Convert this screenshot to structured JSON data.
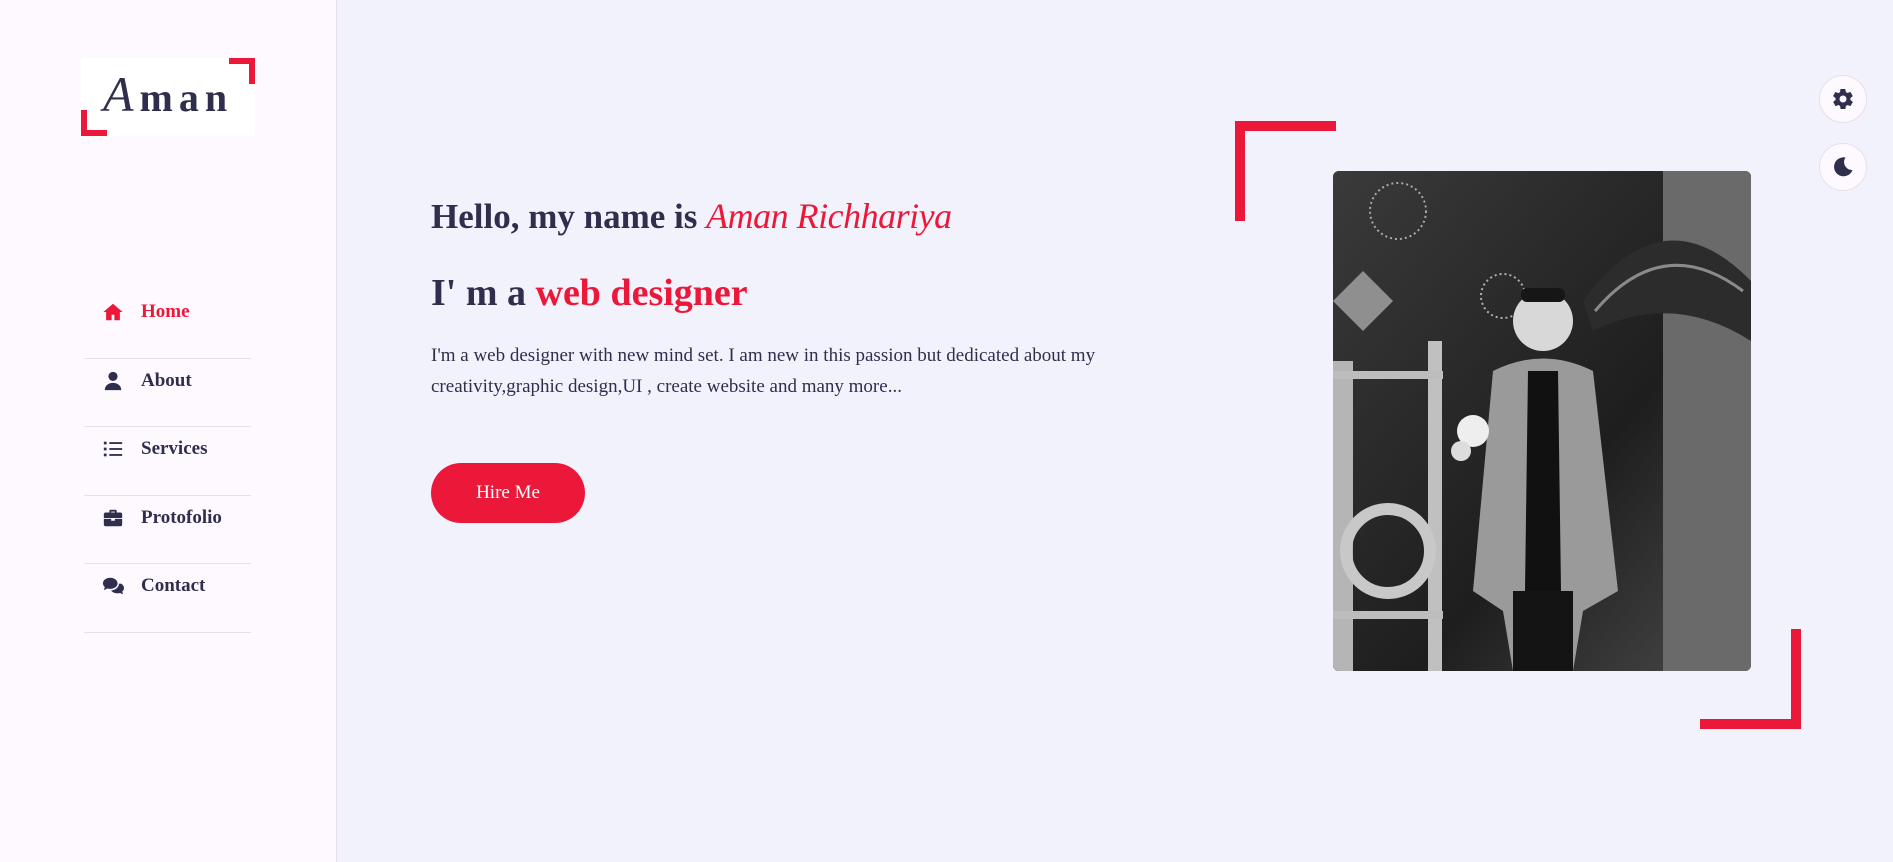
{
  "logo": {
    "initial": "A",
    "rest": "man"
  },
  "nav": {
    "items": [
      {
        "label": "Home",
        "icon": "home-icon",
        "active": true
      },
      {
        "label": "About",
        "icon": "user-icon",
        "active": false
      },
      {
        "label": "Services",
        "icon": "list-icon",
        "active": false
      },
      {
        "label": "Protofolio",
        "icon": "briefcase-icon",
        "active": false
      },
      {
        "label": "Contact",
        "icon": "comments-icon",
        "active": false
      }
    ]
  },
  "hero": {
    "greeting": "Hello, my name is",
    "name": "Aman Richhariya",
    "role_prefix": "I' m a",
    "role_highlight": "web designer",
    "intro": "I'm a web designer with new mind set. I am new in this passion but dedicated about my creativity,graphic design,UI , create website and many more...",
    "cta_label": "Hire Me"
  },
  "controls": {
    "settings_icon": "gear-icon",
    "theme_icon": "moon-icon"
  },
  "colors": {
    "accent": "#ec1839",
    "text": "#302e4d",
    "background": "#f2f2fc",
    "sidebar": "#fdf9ff"
  }
}
